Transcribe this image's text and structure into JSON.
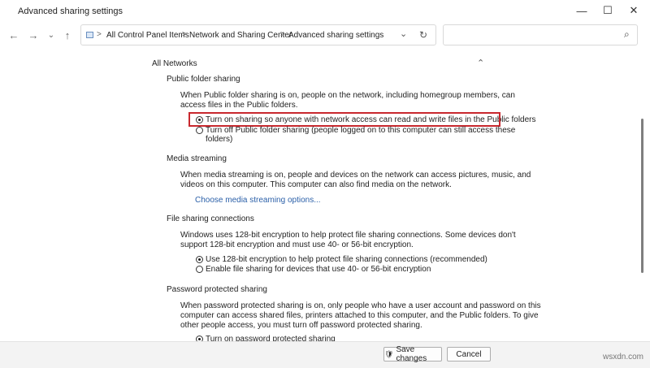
{
  "window": {
    "title": "Advanced sharing settings",
    "minimize_glyph": "—",
    "maximize_glyph": "☐",
    "close_glyph": "✕"
  },
  "nav": {
    "back_glyph": "←",
    "forward_glyph": "→",
    "recent_glyph": "⌄",
    "up_glyph": "↑"
  },
  "address": {
    "breadcrumbs": [
      "All Control Panel Items",
      "Network and Sharing Center",
      "Advanced sharing settings"
    ],
    "separator": ">",
    "dropdown_glyph": "⌄",
    "refresh_glyph": "↻"
  },
  "search": {
    "placeholder": "",
    "icon_glyph": "⌕"
  },
  "sections": {
    "all_networks": {
      "label": "All Networks",
      "collapse_glyph": "⌃"
    },
    "public_folder": {
      "heading": "Public folder sharing",
      "desc_line1": "When Public folder sharing is on, people on the network, including homegroup members, can",
      "desc_line2": "access files in the Public folders.",
      "option1": "Turn on sharing so anyone with network access can read and write files in the Public folders",
      "option2_line1": "Turn off Public folder sharing (people logged on to this computer can still access these",
      "option2_line2": "folders)"
    },
    "media": {
      "heading": "Media streaming",
      "desc_line1": "When media streaming is on, people and devices on the network can access pictures, music, and",
      "desc_line2": "videos on this computer. This computer can also find media on the network.",
      "link": "Choose media streaming options..."
    },
    "file_sharing": {
      "heading": "File sharing connections",
      "desc_line1": "Windows uses 128-bit encryption to help protect file sharing connections. Some devices don't",
      "desc_line2": "support 128-bit encryption and must use 40- or 56-bit encryption.",
      "option1": "Use 128-bit encryption to help protect file sharing connections (recommended)",
      "option2": "Enable file sharing for devices that use 40- or 56-bit encryption"
    },
    "password": {
      "heading": "Password protected sharing",
      "desc_line1": "When password protected sharing is on, only people who have a user account and password on this",
      "desc_line2": "computer can access shared files, printers attached to this computer, and the Public folders. To give",
      "desc_line3": "other people access, you must turn off password protected sharing.",
      "option1": "Turn on password protected sharing"
    }
  },
  "footer": {
    "save_label": "Save changes",
    "save_icon_glyph": "🛡",
    "cancel_label": "Cancel"
  },
  "watermark": "wsxdn.com",
  "colors": {
    "highlight_border": "#c8282e",
    "link": "#2a5fa8"
  }
}
